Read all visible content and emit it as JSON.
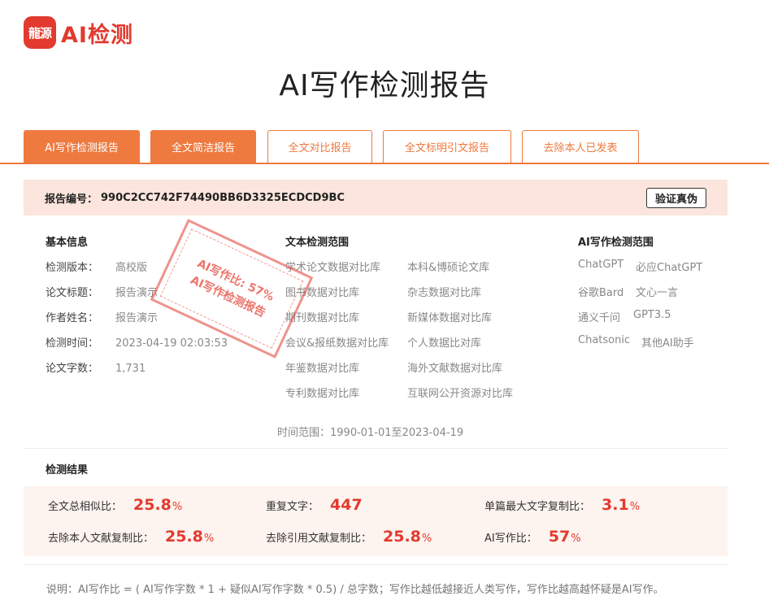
{
  "brand": {
    "logo_mark": "龍源",
    "logo_text": "AI检测"
  },
  "title": "AI写作检测报告",
  "tabs": [
    {
      "label": "AI写作检测报告",
      "active": true
    },
    {
      "label": "全文简洁报告",
      "active": true
    },
    {
      "label": "全文对比报告",
      "active": false
    },
    {
      "label": "全文标明引文报告",
      "active": false
    },
    {
      "label": "去除本人已发表",
      "active": false
    }
  ],
  "report": {
    "id_label": "报告编号：",
    "id_value": "990C2CC742F74490BB6D3325ECDCD9BC",
    "verify_label": "验证真伪"
  },
  "basic": {
    "heading": "基本信息",
    "rows": [
      {
        "k": "检测版本：",
        "v": "高校版"
      },
      {
        "k": "论文标题：",
        "v": "报告演示"
      },
      {
        "k": "作者姓名：",
        "v": "报告演示"
      },
      {
        "k": "检测时间：",
        "v": "2023-04-19 02:03:53"
      },
      {
        "k": "论文字数：",
        "v": "1,731"
      }
    ]
  },
  "scope": {
    "heading": "文本检测范围",
    "col1": [
      "学术论文数据对比库",
      "图书数据对比库",
      "期刊数据对比库",
      "会议&报纸数据对比库",
      "年鉴数据对比库",
      "专利数据对比库"
    ],
    "col2": [
      "本科&博硕论文库",
      "杂志数据对比库",
      "新媒体数据对比库",
      "个人数据比对库",
      "海外文献数据对比库",
      "互联网公开资源对比库"
    ],
    "time_range": "时间范围：1990-01-01至2023-04-19"
  },
  "ai_scope": {
    "heading": "AI写作检测范围",
    "rows": [
      [
        "ChatGPT",
        "必应ChatGPT"
      ],
      [
        "谷歌Bard",
        "文心一言"
      ],
      [
        "通义千问",
        "GPT3.5"
      ],
      [
        "Chatsonic",
        "其他AI助手"
      ]
    ]
  },
  "results": {
    "heading": "检测结果",
    "metrics": [
      {
        "label": "全文总相似比：",
        "value": "25.8",
        "unit": "%"
      },
      {
        "label": "重复文字：",
        "value": "447",
        "unit": ""
      },
      {
        "label": "单篇最大文字复制比：",
        "value": "3.1",
        "unit": "%"
      },
      {
        "label": "去除本人文献复制比：",
        "value": "25.8",
        "unit": "%"
      },
      {
        "label": "去除引用文献复制比：",
        "value": "25.8",
        "unit": "%"
      },
      {
        "label": "AI写作比：",
        "value": "57",
        "unit": "%"
      }
    ]
  },
  "stamp": {
    "line1": "AI写作比: 57%",
    "line2": "AI写作检测报告"
  },
  "note": "说明：AI写作比 = ( AI写作字数 * 1 + 疑似AI写作字数 * 0.5) / 总字数；写作比越低越接近人类写作，写作比越高越怀疑是AI写作。",
  "colors": {
    "accent": "#ee7a3f",
    "brand_red": "#e23a2e",
    "report_bar_bg": "#fbe5dc",
    "result_bg": "#fdf3ef"
  }
}
